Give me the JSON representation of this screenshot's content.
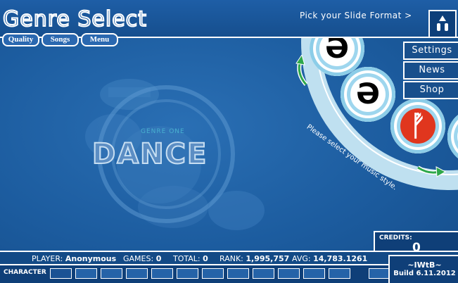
{
  "header": {
    "title": "Genre Select",
    "tabs": [
      "Quality",
      "Songs",
      "Menu"
    ],
    "pick_format": "Pick your Slide Format >"
  },
  "side_menu": [
    "Settings",
    "News",
    "Shop"
  ],
  "wheel": {
    "hint": "Please select your music style.",
    "discs": [
      {
        "glyph": "Ə",
        "color": "#000000"
      },
      {
        "glyph": "Ə",
        "color": "#000000"
      },
      {
        "glyph": "ᚡ",
        "color": "#e0361e"
      }
    ]
  },
  "genre": {
    "number": "GENRE ONE",
    "name": "DANCE"
  },
  "credits": {
    "label": "CREDITS:",
    "value": "0"
  },
  "stats": {
    "player_label": "PLAYER:",
    "player": "Anonymous",
    "games_label": "GAMES:",
    "games": "0",
    "total_label": "TOTAL:",
    "total": "0",
    "rank_label": "RANK:",
    "rank": "1,995,757",
    "avg_label": "AVG:",
    "avg": "14,783.1261"
  },
  "character": {
    "label": "CHARACTER"
  },
  "build": {
    "name": "~IWtB~",
    "version": "Build 6.11.2012"
  },
  "colors": {
    "accent": "#1a5aa0",
    "ring": "#bfe0f0",
    "highlight": "#e0361e"
  }
}
